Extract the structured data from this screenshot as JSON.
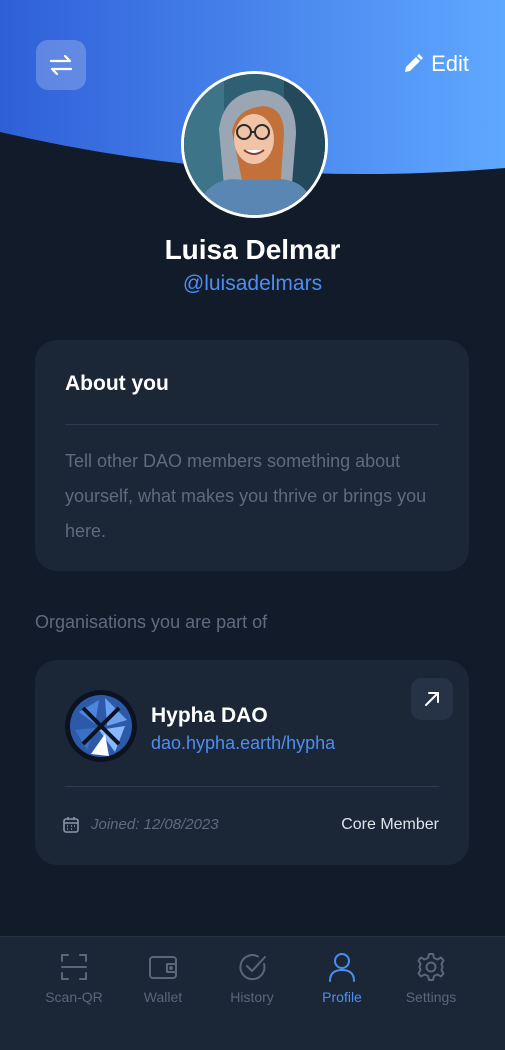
{
  "header": {
    "edit_label": "Edit"
  },
  "profile": {
    "name": "Luisa Delmar",
    "handle": "@luisadelmars"
  },
  "about": {
    "title": "About you",
    "placeholder": "Tell other DAO members something about yourself, what makes you thrive or brings you here."
  },
  "organisations": {
    "heading": "Organisations you are part of",
    "items": [
      {
        "name": "Hypha DAO",
        "url": "dao.hypha.earth/hypha",
        "joined": "Joined: 12/08/2023",
        "role": "Core Member"
      }
    ]
  },
  "nav": {
    "items": [
      {
        "label": "Scan-QR",
        "icon": "scan-qr-icon"
      },
      {
        "label": "Wallet",
        "icon": "wallet-icon"
      },
      {
        "label": "History",
        "icon": "history-icon"
      },
      {
        "label": "Profile",
        "icon": "profile-icon"
      },
      {
        "label": "Settings",
        "icon": "settings-icon"
      }
    ],
    "active": "Profile"
  },
  "colors": {
    "background": "#121b2a",
    "card": "#1b2637",
    "accent": "#4d8ef0",
    "header_gradient_start": "#2f5fd8",
    "header_gradient_end": "#5fa8ff"
  }
}
